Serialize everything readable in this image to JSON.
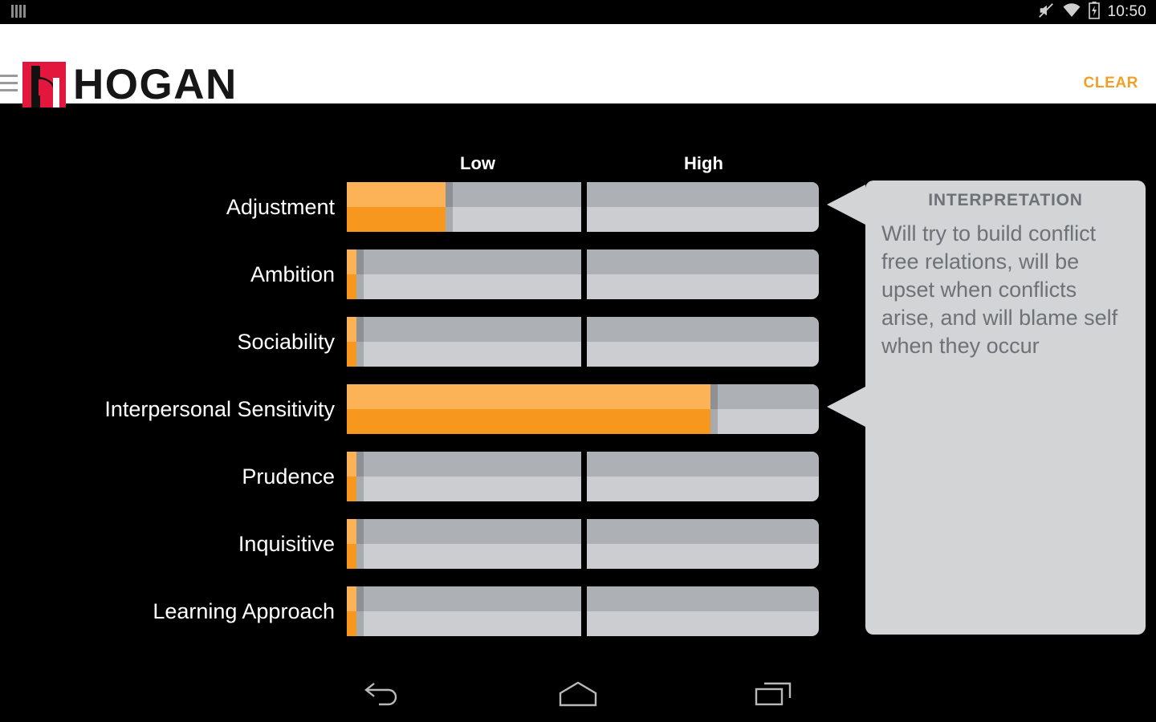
{
  "statusbar": {
    "clock": "10:50",
    "icons": [
      "signal-bars-icon",
      "volume-mute-icon",
      "wifi-icon",
      "battery-charging-icon"
    ]
  },
  "appbar": {
    "menu_icon": "hamburger-menu-icon",
    "logo_text": "HOGAN",
    "logo_mark": "hogan-h-logo-icon",
    "clear_label": "CLEAR"
  },
  "panel": {
    "title": "INTERPRETATION",
    "body": "Will try to build conflict free relations, will be upset when conflicts arise, and will blame self when they occur"
  },
  "navbar": {
    "back": "back-icon",
    "home": "home-icon",
    "recents": "recents-icon"
  },
  "colors": {
    "accent_orange": "#f8971d",
    "orange_light": "#fcb257",
    "brand_red": "#e3173e",
    "track_top": "#adb0b4",
    "track_bottom": "#cccdd0",
    "divider": "#8d9094",
    "panel_bg": "#d2d4d6",
    "panel_text": "#6d7276",
    "background": "#000000"
  },
  "chart_data": {
    "type": "bar",
    "title": "",
    "xlabel": "",
    "ylabel": "",
    "axis_ticks": [
      "Low",
      "High"
    ],
    "orientation": "horizontal",
    "grid": false,
    "legend": "none",
    "xlim": [
      0,
      100
    ],
    "note": "Each row is a single horizontal gauge split visually into a Low half and a High half; the orange fill length encodes the percentile score.",
    "categories": [
      "Adjustment",
      "Ambition",
      "Sociability",
      "Interpersonal Sensitivity",
      "Prudence",
      "Inquisitive",
      "Learning Approach"
    ],
    "values": [
      21,
      2,
      2,
      77,
      2,
      2,
      2
    ],
    "selected": [
      "Adjustment",
      "Interpersonal Sensitivity"
    ]
  }
}
